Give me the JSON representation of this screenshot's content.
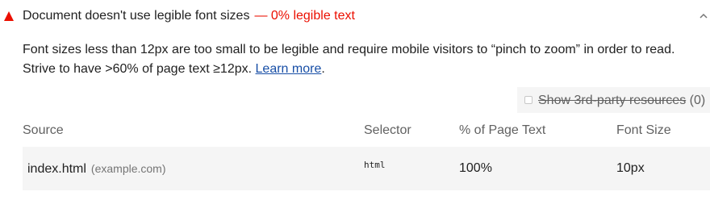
{
  "audit": {
    "title": "Document doesn't use legible font sizes",
    "display_value": "— 0% legible text",
    "status_color": "#eb0f00",
    "status_icon": "fail-triangle-icon"
  },
  "description": {
    "text": "Font sizes less than 12px are too small to be legible and require mobile visitors to “pinch to zoom” in order to read. Strive to have >60% of page text ≥12px.",
    "link_text": "Learn more",
    "trailing": "."
  },
  "filter": {
    "label": "Show 3rd-party resources",
    "count": "(0)",
    "checked": false
  },
  "table": {
    "headers": [
      "Source",
      "Selector",
      "% of Page Text",
      "Font Size"
    ],
    "rows": [
      {
        "source": "index.html",
        "host": "(example.com)",
        "selector": "html",
        "percent": "100%",
        "font_size": "10px"
      }
    ]
  }
}
